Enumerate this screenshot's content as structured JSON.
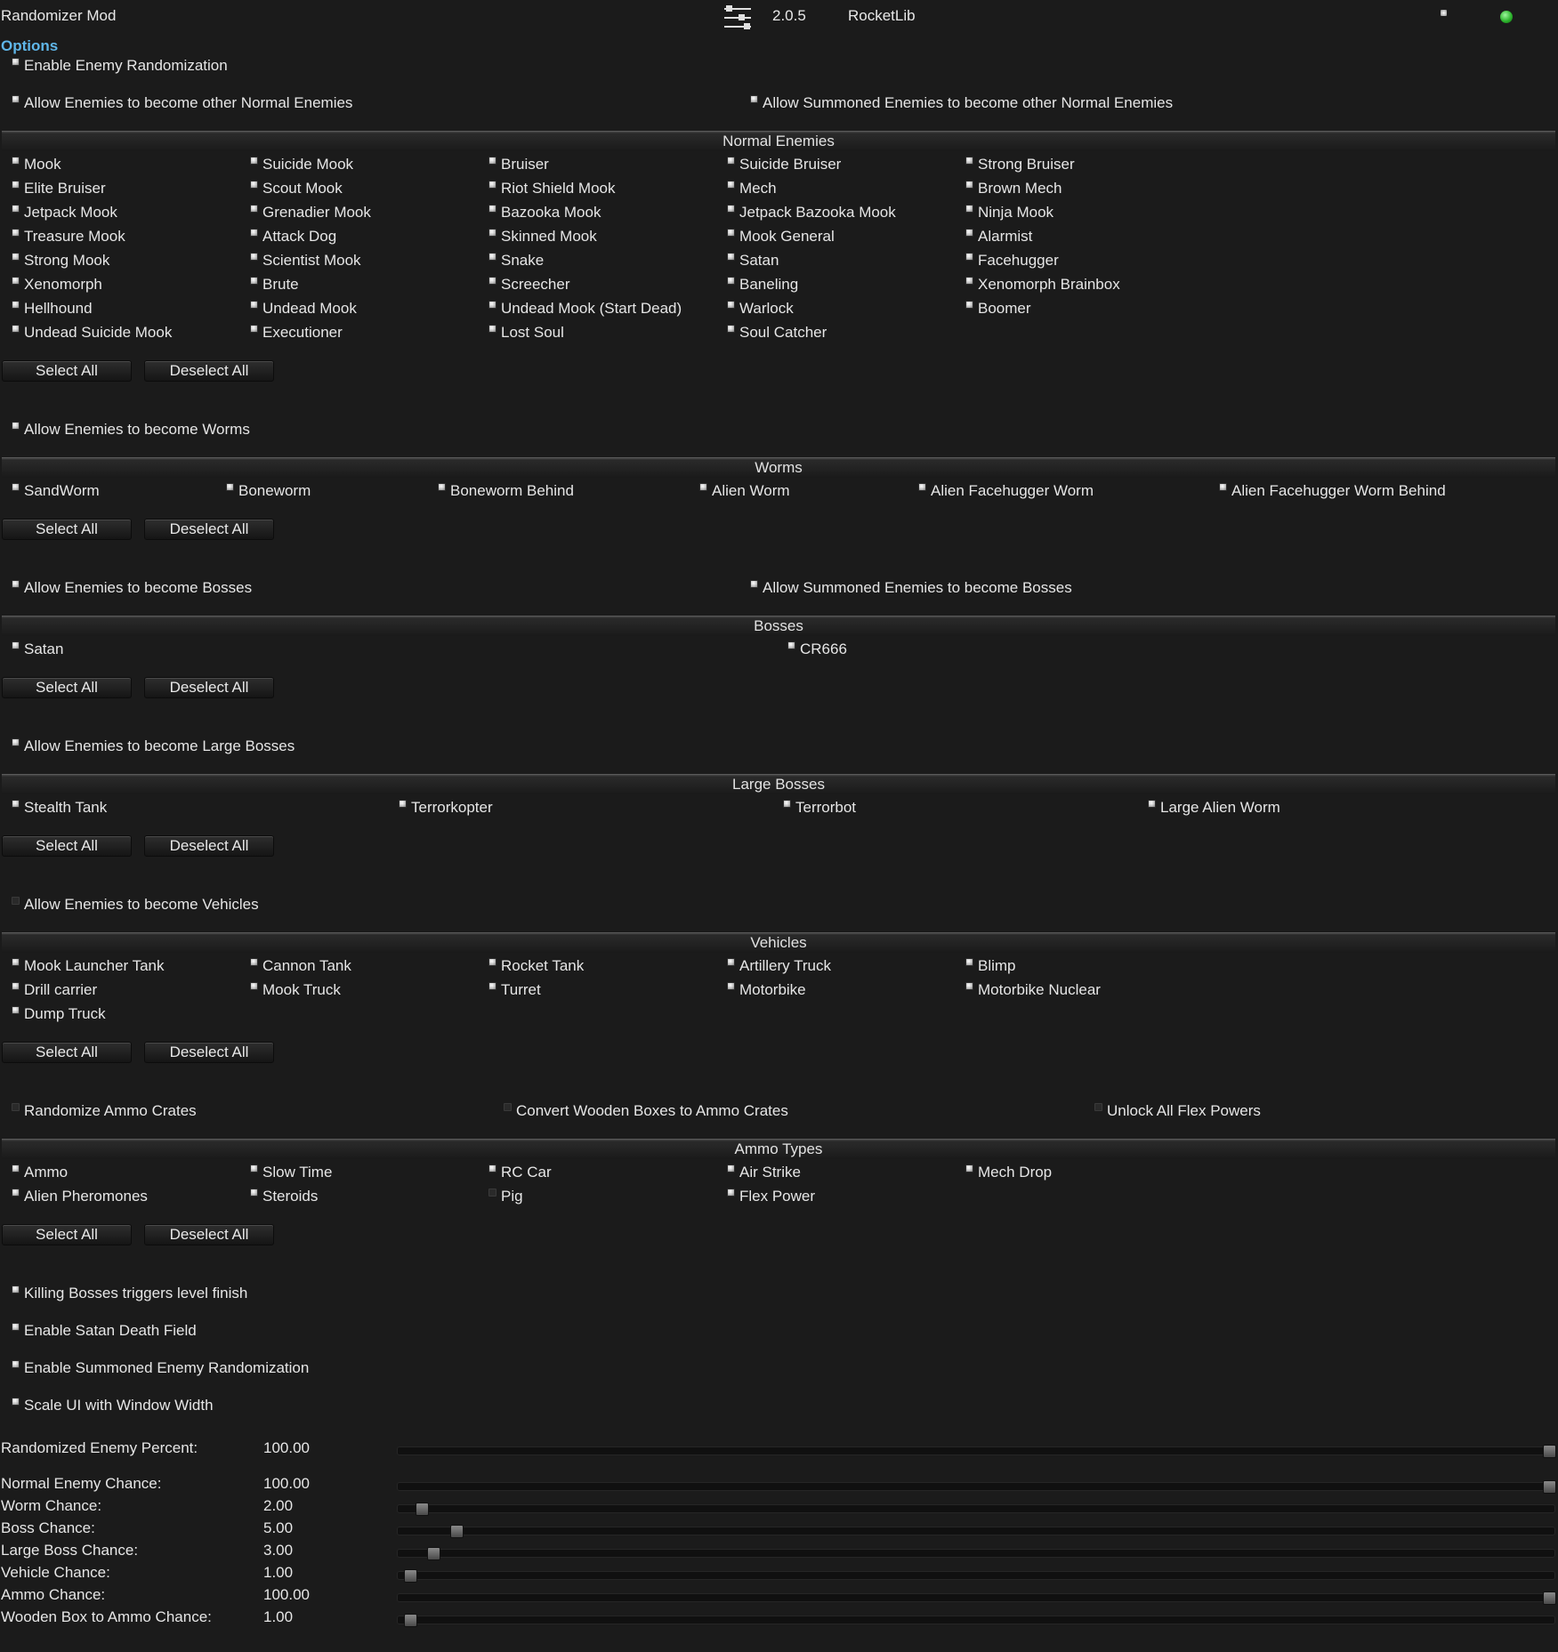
{
  "header": {
    "mod_name": "Randomizer Mod",
    "version": "2.0.5",
    "lib_name": "RocketLib",
    "settings_icon": "sliders-icon",
    "status_color": "#2fb52f"
  },
  "options_label": "Options",
  "enable_randomization": "Enable Enemy Randomization",
  "allow_normal": "Allow Enemies to become other Normal Enemies",
  "allow_summoned_normal": "Allow Summoned Enemies to become other Normal Enemies",
  "normal": {
    "title": "Normal Enemies",
    "items": [
      "Mook",
      "Suicide Mook",
      "Bruiser",
      "Suicide Bruiser",
      "Strong Bruiser",
      "Elite Bruiser",
      "Scout Mook",
      "Riot Shield Mook",
      "Mech",
      "Brown Mech",
      "Jetpack Mook",
      "Grenadier Mook",
      "Bazooka Mook",
      "Jetpack Bazooka Mook",
      "Ninja Mook",
      "Treasure Mook",
      "Attack Dog",
      "Skinned Mook",
      "Mook General",
      "Alarmist",
      "Strong Mook",
      "Scientist Mook",
      "Snake",
      "Satan",
      "Facehugger",
      "Xenomorph",
      "Brute",
      "Screecher",
      "Baneling",
      "Xenomorph Brainbox",
      "Hellhound",
      "Undead Mook",
      "Undead Mook (Start Dead)",
      "Warlock",
      "Boomer",
      "Undead Suicide Mook",
      "Executioner",
      "Lost Soul",
      "Soul Catcher"
    ]
  },
  "buttons": {
    "select_all": "Select All",
    "deselect_all": "Deselect All"
  },
  "allow_worms": "Allow Enemies to become Worms",
  "worms": {
    "title": "Worms",
    "items": [
      "SandWorm",
      "Boneworm",
      "Boneworm Behind",
      "Alien Worm",
      "Alien Facehugger Worm",
      "Alien Facehugger Worm Behind"
    ]
  },
  "allow_bosses": "Allow Enemies to become Bosses",
  "allow_summoned_bosses": "Allow Summoned Enemies to become Bosses",
  "bosses": {
    "title": "Bosses",
    "items": [
      "Satan",
      "CR666"
    ]
  },
  "allow_large_bosses": "Allow Enemies to become Large Bosses",
  "large_bosses": {
    "title": "Large Bosses",
    "items": [
      "Stealth Tank",
      "Terrorkopter",
      "Terrorbot",
      "Large Alien Worm"
    ]
  },
  "allow_vehicles": "Allow Enemies to become Vehicles",
  "vehicles": {
    "title": "Vehicles",
    "items": [
      "Mook Launcher Tank",
      "Cannon Tank",
      "Rocket Tank",
      "Artillery Truck",
      "Blimp",
      "Drill carrier",
      "Mook Truck",
      "Turret",
      "Motorbike",
      "Motorbike Nuclear",
      "Dump Truck"
    ]
  },
  "randomize_ammo": "Randomize Ammo Crates",
  "convert_boxes": "Convert Wooden Boxes to Ammo Crates",
  "unlock_flex": "Unlock All Flex Powers",
  "ammo": {
    "title": "Ammo Types",
    "items": [
      "Ammo",
      "Slow Time",
      "RC Car",
      "Air Strike",
      "Mech Drop",
      "Alien Pheromones",
      "Steroids",
      "Pig",
      "Flex Power"
    ],
    "unchecked": [
      "Pig"
    ]
  },
  "killing_bosses": "Killing Bosses triggers level finish",
  "satan_field": "Enable Satan Death Field",
  "summoned_random": "Enable Summoned Enemy Randomization",
  "scale_ui": "Scale UI with Window Width",
  "sliders": [
    {
      "label": "Randomized Enemy Percent:",
      "value": "100.00",
      "level": 1.0
    },
    {
      "label": "Normal Enemy Chance:",
      "value": "100.00",
      "level": 1.0
    },
    {
      "label": "Worm Chance:",
      "value": "2.00",
      "level": 0.02
    },
    {
      "label": "Boss Chance:",
      "value": "5.00",
      "level": 0.05
    },
    {
      "label": "Large Boss Chance:",
      "value": "3.00",
      "level": 0.03
    },
    {
      "label": "Vehicle Chance:",
      "value": "1.00",
      "level": 0.01
    },
    {
      "label": "Ammo Chance:",
      "value": "100.00",
      "level": 1.0
    },
    {
      "label": "Wooden Box to Ammo Chance:",
      "value": "1.00",
      "level": 0.01
    }
  ]
}
